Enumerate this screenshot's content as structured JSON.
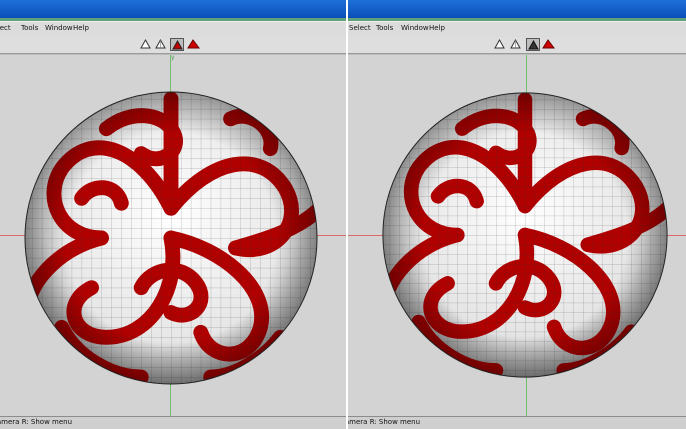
{
  "colors": {
    "titlebar": "#0b4fb8",
    "viewport_bg": "#d3d3d3",
    "pattern_red": "#b00000",
    "mesh_white": "#f0f0f0",
    "axis_green": "#6fbf6f",
    "axis_red": "#d86a6a"
  },
  "left_view": {
    "menu": [
      "Select",
      "Tools",
      "Window",
      "Help"
    ],
    "toolbar_icons": [
      "wireframe-shaded-icon",
      "smooth-shaded-icon",
      "flat-shaded-icon",
      "solid-shaded-icon"
    ],
    "axis_label": "y",
    "status": "Camera   R: Show menu"
  },
  "right_view": {
    "menu": [
      "Select",
      "Tools",
      "Window",
      "Help"
    ],
    "toolbar_icons": [
      "wireframe-shaded-icon",
      "smooth-shaded-icon",
      "flat-shaded-icon",
      "solid-shaded-icon"
    ],
    "status": "Camera   R: Show menu"
  }
}
